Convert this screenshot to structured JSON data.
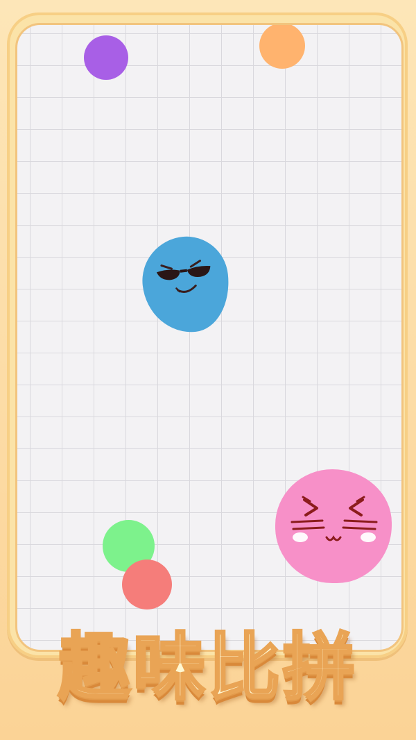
{
  "title": "趣味比拼",
  "players": [
    {
      "id": "blue",
      "color": "#4BA6DA",
      "expression": "sunglasses-smirk"
    },
    {
      "id": "pink",
      "color": "#F790C8",
      "expression": "squint-cat-whiskers"
    }
  ],
  "balls": [
    {
      "id": "purple",
      "color": "#A85FE6"
    },
    {
      "id": "orange",
      "color": "#FFB36E"
    },
    {
      "id": "green",
      "color": "#7DF28C"
    },
    {
      "id": "red",
      "color": "#F57D7A"
    }
  ],
  "colors": {
    "frame": "#FBE3A8",
    "grid_bg": "#F3F2F4",
    "grid_line": "#D9D8DD",
    "title_fill": "#FFF7D2",
    "title_stroke": "#E9A455"
  }
}
